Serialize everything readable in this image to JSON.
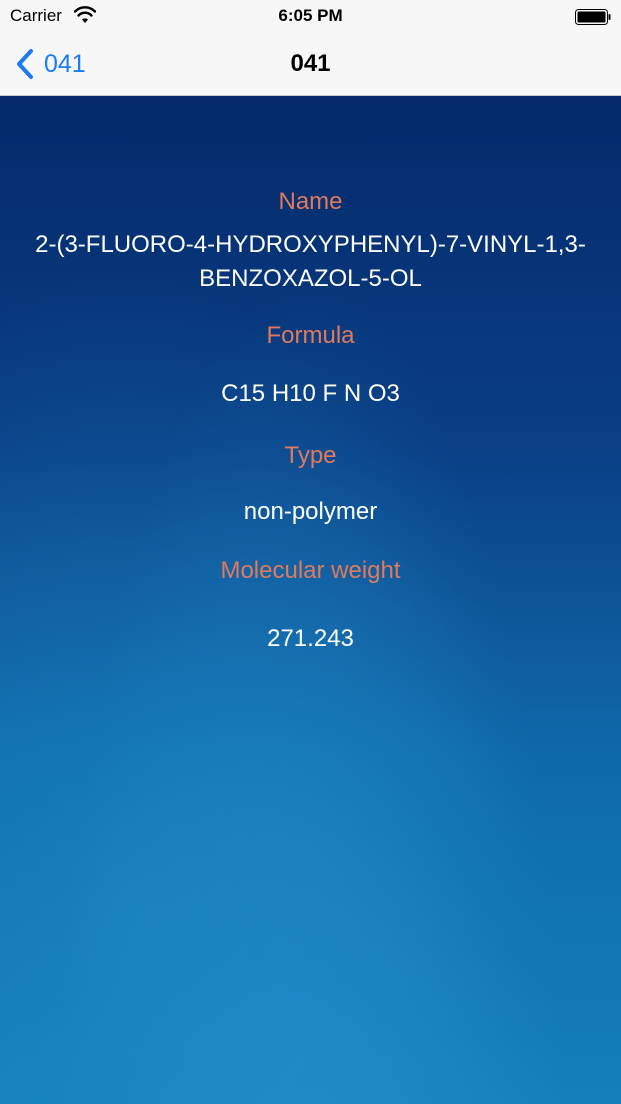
{
  "status_bar": {
    "carrier": "Carrier",
    "time": "6:05 PM",
    "icons": [
      "wifi-icon",
      "battery-icon"
    ]
  },
  "nav": {
    "back_label": "041",
    "title": "041",
    "accent_color": "#1a7cf5"
  },
  "details": {
    "name_label": "Name",
    "name_value": "2-(3-FLUORO-4-HYDROXYPHENYL)-7-VINYL-1,3-BENZOXAZOL-5-OL",
    "formula_label": "Formula",
    "formula_value": "C15 H10 F N O3",
    "type_label": "Type",
    "type_value": "non-polymer",
    "mw_label": "Molecular weight",
    "mw_value": "271.243",
    "label_color": "#e07a5a",
    "value_color": "#ffffff"
  }
}
